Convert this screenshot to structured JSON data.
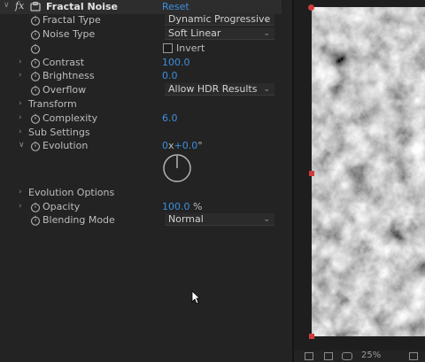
{
  "effect": {
    "name": "Fractal Noise",
    "fx_label": "fx",
    "reset_label": "Reset"
  },
  "props": {
    "fractal_type": {
      "label": "Fractal Type",
      "value": "Dynamic Progressive"
    },
    "noise_type": {
      "label": "Noise Type",
      "value": "Soft Linear"
    },
    "invert": {
      "label": "Invert",
      "checked": false
    },
    "contrast": {
      "label": "Contrast",
      "value": "100.0"
    },
    "brightness": {
      "label": "Brightness",
      "value": "0.0"
    },
    "overflow": {
      "label": "Overflow",
      "value": "Allow HDR Results"
    },
    "transform": {
      "label": "Transform"
    },
    "complexity": {
      "label": "Complexity",
      "value": "6.0"
    },
    "sub_settings": {
      "label": "Sub Settings"
    },
    "evolution": {
      "label": "Evolution",
      "revolutions": "0",
      "x": "x",
      "degrees": "+0.0",
      "deg_sign": "°"
    },
    "evolution_options": {
      "label": "Evolution Options"
    },
    "opacity": {
      "label": "Opacity",
      "value": "100.0",
      "unit": "%"
    },
    "blending_mode": {
      "label": "Blending Mode",
      "value": "Normal"
    }
  },
  "viewer": {
    "zoom": "25%"
  },
  "colors": {
    "accent_blue": "#3e8ede",
    "handle_red": "#d03a3a",
    "panel_bg": "#232323"
  }
}
